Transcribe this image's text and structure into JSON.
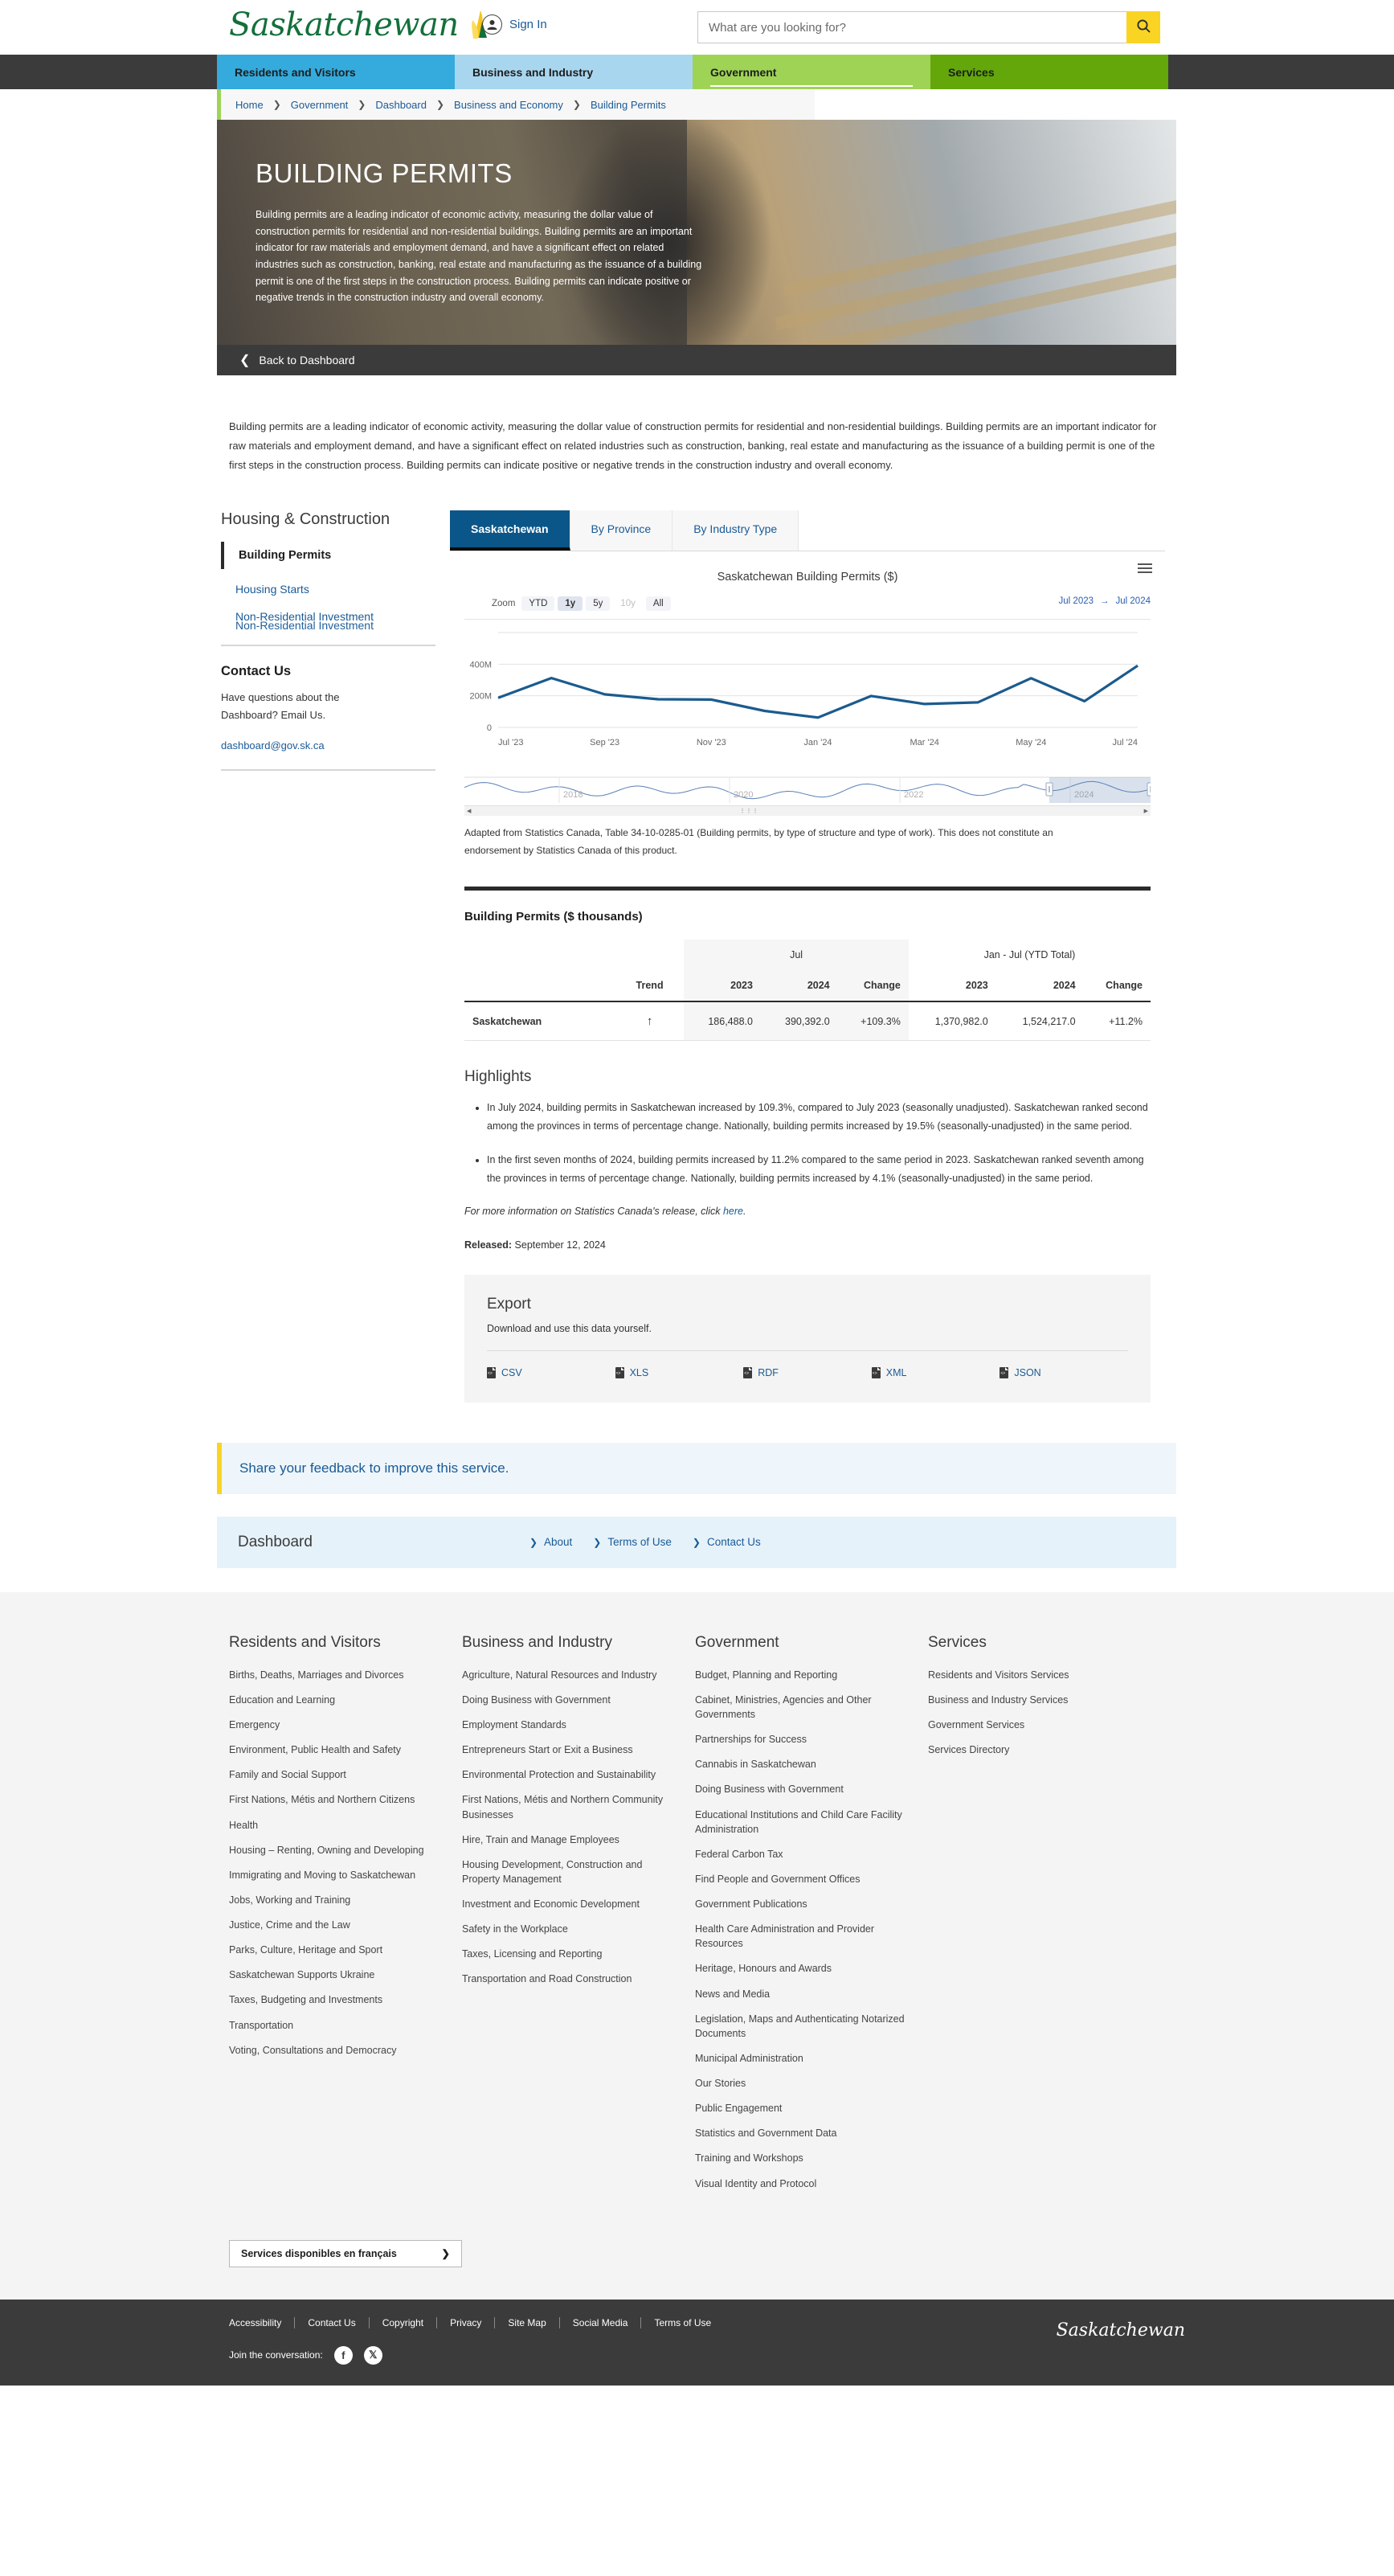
{
  "header": {
    "logo_text": "Saskatchewan",
    "signin_label": "Sign In",
    "search_placeholder": "What are you looking for?",
    "search_value": "",
    "search_icon": "search-icon"
  },
  "mainnav": [
    {
      "label": "Residents and Visitors",
      "color": "#35aadc"
    },
    {
      "label": "Business and Industry",
      "color": "#a8d6ee"
    },
    {
      "label": "Government",
      "color": "#9fd356"
    },
    {
      "label": "Services",
      "color": "#63a70a"
    }
  ],
  "breadcrumb": [
    "Home",
    "Government",
    "Dashboard",
    "Business and Economy",
    "Building Permits"
  ],
  "hero": {
    "title": "BUILDING PERMITS",
    "description": "Building permits are a leading indicator of economic activity, measuring the dollar value of construction permits for residential and non-residential buildings. Building permits are an important indicator for raw materials and employment demand, and have a significant effect on related industries such as construction, banking, real estate and manufacturing as the issuance of a building permit is one of the first steps in the construction process. Building permits can indicate positive or negative trends in the construction industry and overall economy.",
    "back_label": "Back to Dashboard"
  },
  "intro": "Building permits are a leading indicator of economic activity, measuring the dollar value of construction permits for residential and non-residential buildings. Building permits are an important indicator for raw materials and employment demand, and have a significant effect on related industries such as construction, banking, real estate and manufacturing as the issuance of a building permit is one of the first steps in the construction process. Building permits can indicate positive or negative trends in the construction industry and overall economy.",
  "sidebar": {
    "heading": "Housing & Construction",
    "active_item": "Building Permits",
    "items": [
      "Housing Starts",
      "Non-Residential Investment"
    ],
    "ghost_item": "Non-Residential Investment",
    "contact": {
      "heading": "Contact Us",
      "text": "Have questions about the Dashboard? Email Us.",
      "email": "dashboard@gov.sk.ca"
    }
  },
  "tabs": [
    {
      "label": "Saskatchewan",
      "active": true
    },
    {
      "label": "By Province",
      "active": false
    },
    {
      "label": "By Industry Type",
      "active": false
    }
  ],
  "chart_controls": {
    "zoom_label": "Zoom",
    "buttons": [
      {
        "label": "YTD",
        "state": "normal"
      },
      {
        "label": "1y",
        "state": "active"
      },
      {
        "label": "5y",
        "state": "normal"
      },
      {
        "label": "10y",
        "state": "disabled"
      },
      {
        "label": "All",
        "state": "normal"
      }
    ],
    "range_from": "Jul 2023",
    "range_arrow": "→",
    "range_to": "Jul 2024",
    "menu_icon": "hamburger-menu-icon"
  },
  "chart_data": {
    "type": "line",
    "title": "Saskatchewan Building Permits ($)",
    "xlabel": "",
    "ylabel": "",
    "ylim": [
      0,
      600000000
    ],
    "yticks": [
      0,
      200000000,
      400000000
    ],
    "ytick_labels": [
      "0",
      "200M",
      "400M"
    ],
    "grid": true,
    "legend": "none",
    "line_color": "#1a5b8f",
    "x": [
      "Jul '23",
      "Aug '23",
      "Sep '23",
      "Oct '23",
      "Nov '23",
      "Dec '23",
      "Jan '24",
      "Feb '24",
      "Mar '24",
      "Apr '24",
      "May '24",
      "Jun '24",
      "Jul '24"
    ],
    "xtick_labels": [
      "Jul '23",
      "Sep '23",
      "Nov '23",
      "Jan '24",
      "Mar '24",
      "May '24",
      "Jul '24"
    ],
    "values": [
      186488000,
      312000000,
      209000000,
      178000000,
      176000000,
      104000000,
      62000000,
      199000000,
      148000000,
      158000000,
      311000000,
      166000000,
      390392000
    ],
    "units": "$",
    "navigator": {
      "year_labels": [
        "2018",
        "2020",
        "2022",
        "2024"
      ],
      "selection_from": "Jul 2023",
      "selection_to": "Jul 2024"
    }
  },
  "attribution": "Adapted from Statistics Canada, Table 34-10-0285-01 (Building permits, by type of structure and type of work). This does not constitute an endorsement by Statistics Canada of this product.",
  "table": {
    "title": "Building Permits ($ thousands)",
    "group_headers": [
      "",
      "",
      "Jul",
      "Jan - Jul (YTD Total)"
    ],
    "columns": [
      "",
      "Trend",
      "2023",
      "2024",
      "Change",
      "2023",
      "2024",
      "Change"
    ],
    "rows": [
      {
        "label": "Saskatchewan",
        "trend": "↑",
        "jul_2023": "186,488.0",
        "jul_2024": "390,392.0",
        "jul_change": "+109.3%",
        "ytd_2023": "1,370,982.0",
        "ytd_2024": "1,524,217.0",
        "ytd_change": "+11.2%"
      }
    ]
  },
  "highlights": {
    "heading": "Highlights",
    "items": [
      "In July 2024, building permits in Saskatchewan increased by 109.3%, compared to July 2023 (seasonally unadjusted). Saskatchewan ranked second among the provinces in terms of percentage change. Nationally, building permits increased by 19.5% (seasonally-unadjusted) in the same period.",
      "In the first seven months of 2024, building permits increased by 11.2% compared to the same period in 2023. Saskatchewan ranked seventh among the provinces in terms of percentage change. Nationally, building permits increased by 4.1% (seasonally-unadjusted) in the same period."
    ],
    "more_info_prefix": "For more information on Statistics Canada's release, click ",
    "more_info_link": "here",
    "more_info_suffix": ".",
    "released_label": "Released:",
    "released_date": "September 12, 2024"
  },
  "export": {
    "heading": "Export",
    "subtitle": "Download and use this data yourself.",
    "formats": [
      "CSV",
      "XLS",
      "RDF",
      "XML",
      "JSON"
    ]
  },
  "feedback": {
    "text": "Share your feedback to improve this service."
  },
  "dashbar": {
    "title": "Dashboard",
    "links": [
      "About",
      "Terms of Use",
      "Contact Us"
    ]
  },
  "footer": {
    "columns": [
      {
        "heading": "Residents and Visitors",
        "links": [
          "Births, Deaths, Marriages and Divorces",
          "Education and Learning",
          "Emergency",
          "Environment, Public Health and Safety",
          "Family and Social Support",
          "First Nations, Métis and Northern Citizens",
          "Health",
          "Housing – Renting, Owning and Developing",
          "Immigrating and Moving to Saskatchewan",
          "Jobs, Working and Training",
          "Justice, Crime and the Law",
          "Parks, Culture, Heritage and Sport",
          "Saskatchewan Supports Ukraine",
          "Taxes, Budgeting and Investments",
          "Transportation",
          "Voting, Consultations and Democracy"
        ]
      },
      {
        "heading": "Business and Industry",
        "links": [
          "Agriculture, Natural Resources and Industry",
          "Doing Business with Government",
          "Employment Standards",
          "Entrepreneurs Start or Exit a Business",
          "Environmental Protection and Sustainability",
          "First Nations, Métis and Northern Community Businesses",
          "Hire, Train and Manage Employees",
          "Housing Development, Construction and Property Management",
          "Investment and Economic Development",
          "Safety in the Workplace",
          "Taxes, Licensing and Reporting",
          "Transportation and Road Construction"
        ]
      },
      {
        "heading": "Government",
        "links": [
          "Budget, Planning and Reporting",
          "Cabinet, Ministries, Agencies and Other Governments",
          "Partnerships for Success",
          "Cannabis in Saskatchewan",
          "Doing Business with Government",
          "Educational Institutions and Child Care Facility Administration",
          "Federal Carbon Tax",
          "Find People and Government Offices",
          "Government Publications",
          "Health Care Administration and Provider Resources",
          "Heritage, Honours and Awards",
          "News and Media",
          "Legislation, Maps and Authenticating Notarized Documents",
          "Municipal Administration",
          "Our Stories",
          "Public Engagement",
          "Statistics and Government Data",
          "Training and Workshops",
          "Visual Identity and Protocol"
        ]
      },
      {
        "heading": "Services",
        "links": [
          "Residents and Visitors Services",
          "Business and Industry Services",
          "Government Services",
          "Services Directory"
        ]
      }
    ],
    "french_button": "Services disponibles en français"
  },
  "bottombar": {
    "links": [
      "Accessibility",
      "Contact Us",
      "Copyright",
      "Privacy",
      "Site Map",
      "Social Media",
      "Terms of Use"
    ],
    "social_label": "Join the conversation:",
    "social_icons": [
      "facebook-icon",
      "x-twitter-icon"
    ],
    "logo_text": "Saskatchewan"
  }
}
